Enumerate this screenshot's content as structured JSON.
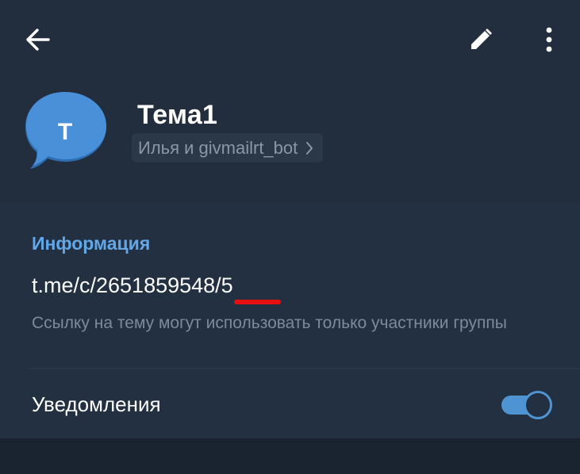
{
  "header": {
    "title": "Тема1",
    "subtitle": "Илья и givmailrt_bot",
    "avatar_letter": "T",
    "icons": [
      "back-arrow-icon",
      "pencil-icon",
      "more-vertical-icon",
      "chevron-right-icon"
    ]
  },
  "info": {
    "section_title": "Информация",
    "link": "t.me/c/2651859548/5",
    "hint": "Ссылку на тему могут использовать только участники группы"
  },
  "notifications": {
    "label": "Уведомления",
    "enabled": true
  },
  "colors": {
    "accent": "#62a8e8",
    "toggle": "#4e94d2",
    "avatar": "#4a90d9",
    "annotation_underline": "#e61010"
  }
}
